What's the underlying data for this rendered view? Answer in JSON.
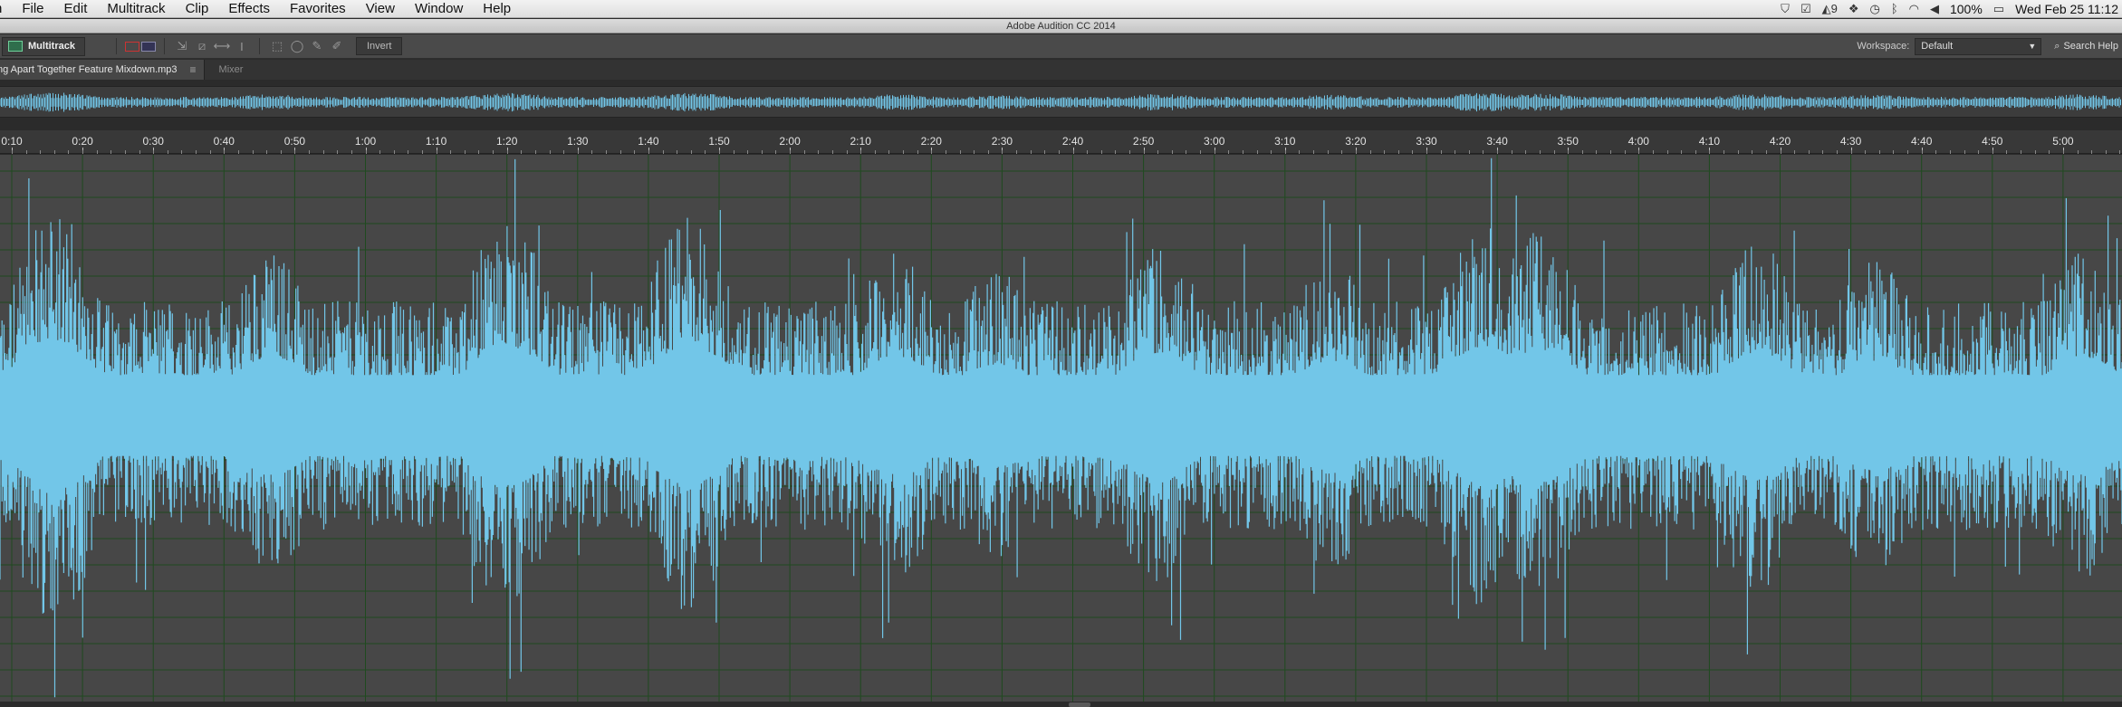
{
  "menubar": {
    "items": [
      "n",
      "File",
      "Edit",
      "Multitrack",
      "Clip",
      "Effects",
      "Favorites",
      "View",
      "Window",
      "Help"
    ],
    "status": {
      "notification_count": "9",
      "battery": "100%",
      "clock": "Wed Feb 25  11:12"
    }
  },
  "window": {
    "title": "Adobe Audition CC 2014"
  },
  "toolbar": {
    "multitrack_label": "Multitrack",
    "invert_label": "Invert",
    "workspace_label": "Workspace:",
    "workspace_value": "Default",
    "search_label": "Search Help"
  },
  "tabs": {
    "active_file": "ng Apart Together Feature Mixdown.mp3",
    "inactive": "Mixer"
  },
  "timeline": {
    "labels": [
      "0:10",
      "0:20",
      "0:30",
      "0:40",
      "0:50",
      "1:00",
      "1:10",
      "1:20",
      "1:30",
      "1:40",
      "1:50",
      "2:00",
      "2:10",
      "2:20",
      "2:30",
      "2:40",
      "2:50",
      "3:00",
      "3:10",
      "3:20",
      "3:30",
      "3:40",
      "3:50",
      "4:00",
      "4:10",
      "4:20",
      "4:30",
      "4:40",
      "4:50",
      "5:00"
    ]
  },
  "colors": {
    "waveform": "#72c6e8",
    "grid": "#1f4a1f",
    "background": "#474747"
  }
}
